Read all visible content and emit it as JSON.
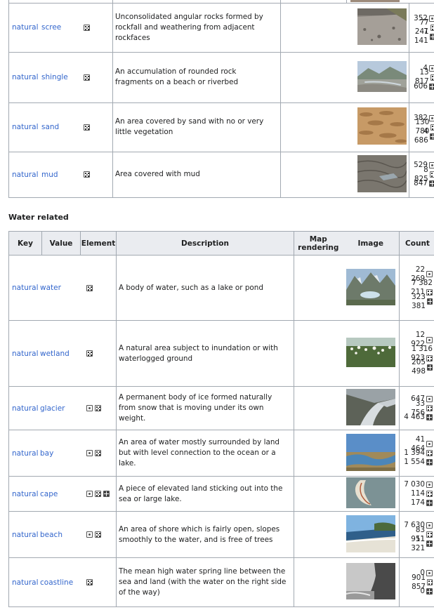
{
  "top_rows": [
    {
      "key": "natural",
      "value": "scree",
      "elements": [
        "area"
      ],
      "description": "Unconsolidated angular rocks formed by rockfall and weathering from adjacent rockfaces",
      "counts": [
        {
          "v": "352",
          "icon": "node"
        },
        {
          "v": "77 241",
          "icon": "way"
        },
        {
          "v": "7 141",
          "icon": "rel"
        }
      ],
      "img": "scree"
    },
    {
      "key": "natural",
      "value": "shingle",
      "elements": [
        "area"
      ],
      "description": "An accumulation of rounded rock fragments on a beach or riverbed",
      "counts": [
        {
          "v": "4",
          "icon": "node"
        },
        {
          "v": "13 817",
          "icon": "way"
        },
        {
          "v": "606",
          "icon": "rel"
        }
      ],
      "img": "shingle"
    },
    {
      "key": "natural",
      "value": "sand",
      "elements": [
        "area"
      ],
      "description": "An area covered by sand with no or very little vegetation",
      "counts": [
        {
          "v": "382",
          "icon": "node"
        },
        {
          "v": "130 780",
          "icon": "way"
        },
        {
          "v": "4 686",
          "icon": "rel"
        }
      ],
      "img": "sand"
    },
    {
      "key": "natural",
      "value": "mud",
      "elements": [
        "area"
      ],
      "description": "Area covered with mud",
      "counts": [
        {
          "v": "529",
          "icon": "node"
        },
        {
          "v": "8 825",
          "icon": "way"
        },
        {
          "v": "847",
          "icon": "rel"
        }
      ],
      "img": "mud"
    }
  ],
  "section_title": "Water related",
  "headers": {
    "key": "Key",
    "value": "Value",
    "element": "Element",
    "description": "Description",
    "map": "Map rendering",
    "image": "Image",
    "count": "Count"
  },
  "water_rows": [
    {
      "key": "natural",
      "value": "water",
      "elements": [
        "area"
      ],
      "description": "A body of water, such as a lake or pond",
      "counts": [
        {
          "v": "22 269",
          "icon": "node"
        },
        {
          "v": "7 382",
          "icon": ""
        },
        {
          "v": "211",
          "icon": "way"
        },
        {
          "v": "323 381",
          "icon": "rel"
        }
      ],
      "img": "water"
    },
    {
      "key": "natural",
      "value": "wetland",
      "elements": [
        "area"
      ],
      "description": "A natural area subject to inundation or with waterlogged ground",
      "counts": [
        {
          "v": "12 922",
          "icon": "node"
        },
        {
          "v": "1 316",
          "icon": ""
        },
        {
          "v": "923",
          "icon": "way"
        },
        {
          "v": "205 498",
          "icon": "rel"
        }
      ],
      "img": "wetland"
    },
    {
      "key": "natural",
      "value": "glacier",
      "elements": [
        "node",
        "area"
      ],
      "description": "A permanent body of ice formed naturally from snow that is moving under its own weight.",
      "counts": [
        {
          "v": "647",
          "icon": "node"
        },
        {
          "v": "33 756",
          "icon": "way"
        },
        {
          "v": "4 463",
          "icon": "rel"
        }
      ],
      "img": "glacier"
    },
    {
      "key": "natural",
      "value": "bay",
      "elements": [
        "node",
        "area"
      ],
      "description": "An area of water mostly surrounded by land but with level connection to the ocean or a lake.",
      "counts": [
        {
          "v": "41 464",
          "icon": "node"
        },
        {
          "v": "1 394",
          "icon": "way"
        },
        {
          "v": "1 554",
          "icon": "rel"
        }
      ],
      "img": "bay"
    },
    {
      "key": "natural",
      "value": "cape",
      "elements": [
        "node",
        "area",
        "rel"
      ],
      "description": "A piece of elevated land sticking out into the sea or large lake.",
      "counts": [
        {
          "v": "7 030",
          "icon": "node"
        },
        {
          "v": "114",
          "icon": "way"
        },
        {
          "v": "174",
          "icon": "rel"
        }
      ],
      "img": "cape"
    },
    {
      "key": "natural",
      "value": "beach",
      "elements": [
        "node",
        "area"
      ],
      "description": "An area of shore which is fairly open, slopes smoothly to the water, and is free of trees",
      "counts": [
        {
          "v": "7 630",
          "icon": "node"
        },
        {
          "v": "83 951",
          "icon": "way"
        },
        {
          "v": "11 321",
          "icon": "rel"
        }
      ],
      "img": "beach"
    },
    {
      "key": "natural",
      "value": "coastline",
      "elements": [
        "area"
      ],
      "description": "The mean high water spring line between the sea and land (with the water on the right side of the way)",
      "counts": [
        {
          "v": "0",
          "icon": "node"
        },
        {
          "v": "901 857",
          "icon": "way"
        },
        {
          "v": "0",
          "icon": "rel"
        }
      ],
      "img": "coastline"
    }
  ],
  "colors": {
    "link": "#3366cc",
    "border": "#a2a9b1",
    "header_bg": "#eaecf0"
  }
}
